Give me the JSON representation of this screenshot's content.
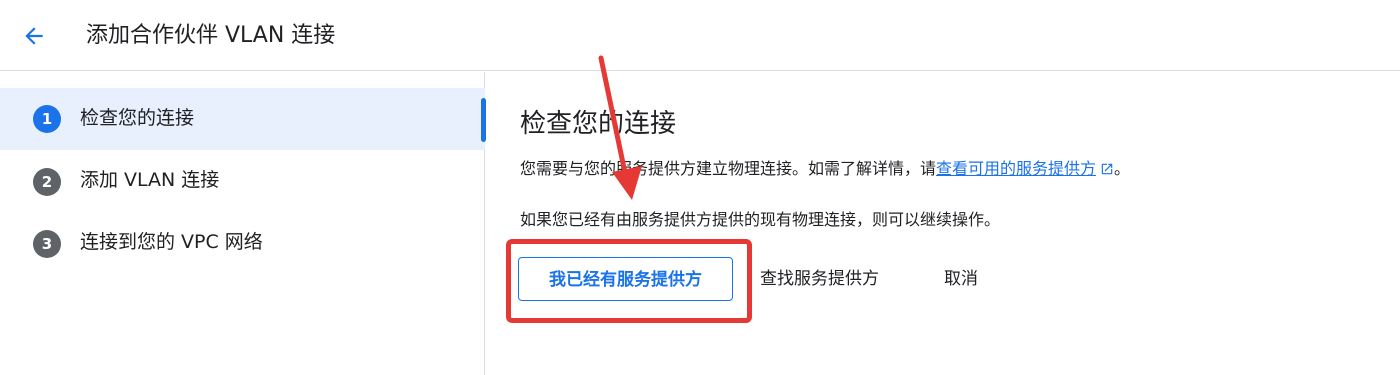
{
  "header": {
    "back_icon": "arrow-left-icon",
    "title": "添加合作伙伴 VLAN 连接"
  },
  "sidebar": {
    "steps": [
      {
        "number": "1",
        "label": "检查您的连接",
        "active": true
      },
      {
        "number": "2",
        "label": "添加 VLAN 连接",
        "active": false
      },
      {
        "number": "3",
        "label": "连接到您的 VPC 网络",
        "active": false
      }
    ]
  },
  "main": {
    "title": "检查您的连接",
    "desc_prefix": "您需要与您的服务提供方建立物理连接。如需了解详情，请",
    "desc_link": "查看可用的服务提供方",
    "desc_suffix": "。",
    "desc2": "如果您已经有由服务提供方提供的现有物理连接，则可以继续操作。",
    "buttons": {
      "have_provider": "我已经有服务提供方",
      "find_provider": "查找服务提供方",
      "cancel": "取消"
    }
  },
  "annotation": {
    "color": "#e53935"
  },
  "colors": {
    "accent": "#1a73e8",
    "active_bg": "#e8f0fe",
    "step_inactive": "#5f6368"
  }
}
